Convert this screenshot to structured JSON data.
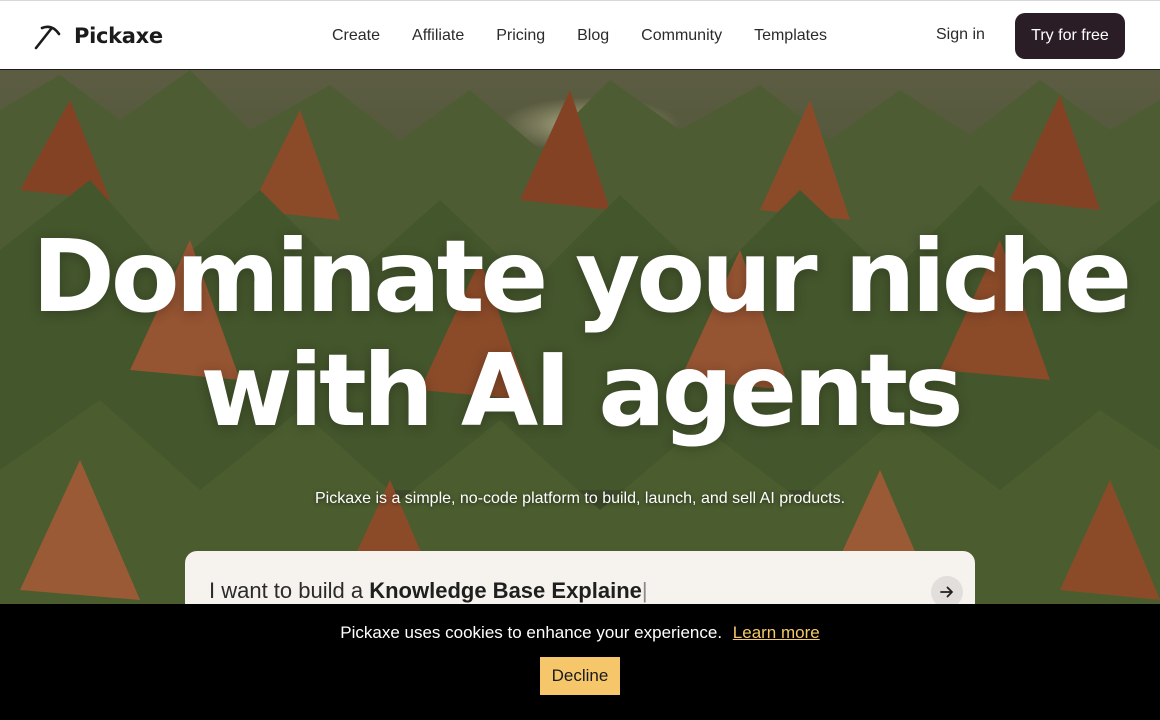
{
  "brand": {
    "name": "Pickaxe",
    "icon": "pickaxe-logo-icon"
  },
  "nav": [
    {
      "label": "Create"
    },
    {
      "label": "Affiliate"
    },
    {
      "label": "Pricing"
    },
    {
      "label": "Blog"
    },
    {
      "label": "Community"
    },
    {
      "label": "Templates"
    }
  ],
  "auth": {
    "signin_label": "Sign in",
    "cta_label": "Try for free"
  },
  "hero": {
    "title_line1": "Dominate your niche",
    "title_line2": "with AI agents",
    "subtitle": "Pickaxe is a simple, no-code platform to build, launch, and sell AI products.",
    "prompt_prefix": "I want to build a",
    "prompt_value": "Knowledge Base Explaine",
    "prompt_cursor": "|",
    "prompt_submit_icon": "arrow-right-icon"
  },
  "cookie_banner": {
    "message": "Pickaxe uses cookies to enhance your experience.",
    "link_label": "Learn more",
    "decline_label": "Decline"
  },
  "colors": {
    "cta_bg": "#2b1d26",
    "cookie_bg": "#000000",
    "accent_yellow": "#f6c76a"
  }
}
